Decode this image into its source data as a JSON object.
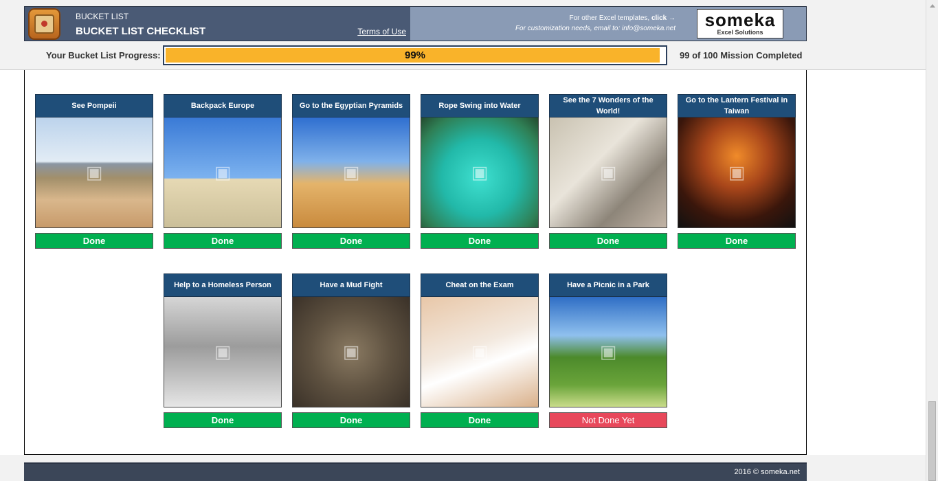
{
  "header": {
    "app_name": "BUCKET LIST",
    "app_title": "BUCKET LIST CHECKLIST",
    "terms_label": "Terms of Use",
    "promo_line1": "For other Excel templates,",
    "promo_line1_link": "click →",
    "promo_line2": "For customization needs, email to: info@someka.net",
    "brand_name": "someka",
    "brand_sub": "Excel Solutions",
    "logo_icon": "bucket-list-app-icon"
  },
  "progress": {
    "label": "Your Bucket List Progress:",
    "percent_text": "99%",
    "fraction": 0.99,
    "count_text": "99 of 100 Mission Completed",
    "fill_color": "#f9b32a"
  },
  "cards": [
    {
      "title": "See Pompeii",
      "status": "Done",
      "photo_icon": "photo-icon"
    },
    {
      "title": "Backpack Europe",
      "status": "Done",
      "photo_icon": "photo-icon"
    },
    {
      "title": "Go to the Egyptian Pyramids",
      "status": "Done",
      "photo_icon": "photo-icon"
    },
    {
      "title": "Rope Swing into Water",
      "status": "Done",
      "photo_icon": "photo-icon"
    },
    {
      "title": "See the 7 Wonders of the World!",
      "status": "Done",
      "photo_icon": "photo-icon"
    },
    {
      "title": "Go to the Lantern Festival in Taiwan",
      "status": "Done",
      "photo_icon": "photo-icon"
    },
    {
      "title": "Help to a Homeless Person",
      "status": "Done",
      "photo_icon": "photo-icon"
    },
    {
      "title": "Have a Mud Fight",
      "status": "Done",
      "photo_icon": "photo-icon"
    },
    {
      "title": "Cheat on the Exam",
      "status": "Done",
      "photo_icon": "photo-icon"
    },
    {
      "title": "Have a Picnic in a Park",
      "status": "Not Done Yet",
      "photo_icon": "photo-icon"
    }
  ],
  "colors": {
    "header_dark": "#4a5a75",
    "header_light": "#8a9bb5",
    "card_title": "#1f4e79",
    "done": "#00b050",
    "not_done": "#e8485b"
  },
  "footer": {
    "copyright": "2016 © someka.net"
  }
}
